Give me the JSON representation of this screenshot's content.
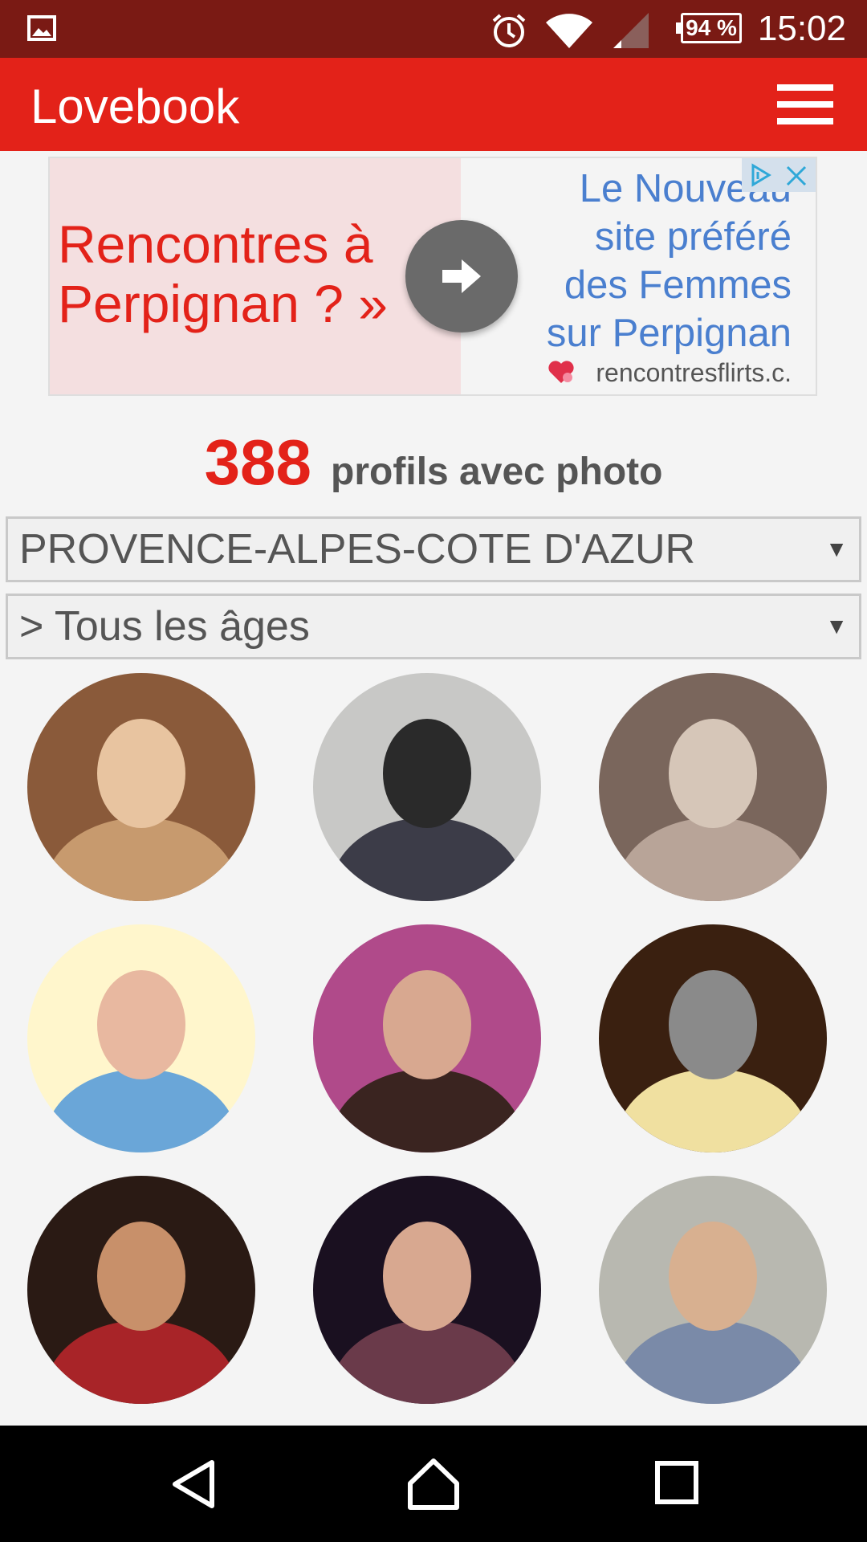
{
  "status_bar": {
    "time": "15:02",
    "battery": "94 %",
    "icons": [
      "gallery-icon",
      "alarm-icon",
      "wifi-icon",
      "signal-icon",
      "battery-icon"
    ]
  },
  "app_bar": {
    "title": "Lovebook",
    "menu_icon": "hamburger-menu-icon"
  },
  "ad": {
    "headline_line1": "Rencontres à",
    "headline_line2": "Perpignan ? »",
    "text_line1": "Le Nouveau",
    "text_line2": "site préféré",
    "text_line3": "des Femmes",
    "text_line4": "sur Perpignan",
    "url": "rencontresflirts.c.",
    "icons": [
      "arrow-right-icon",
      "heart-icon",
      "adchoices-icon",
      "close-icon"
    ]
  },
  "profiles": {
    "count": "388",
    "count_label": "profils avec photo"
  },
  "filters": {
    "region": "PROVENCE-ALPES-COTE D'AZUR",
    "age": "> Tous les âges",
    "caret": "▼"
  },
  "profile_photos": [
    {
      "colors": [
        "#8a5a3a",
        "#c79a6e",
        "#e8c4a0"
      ]
    },
    {
      "colors": [
        "#c8c8c6",
        "#3c3c48",
        "#2a2a2a"
      ]
    },
    {
      "colors": [
        "#7a665c",
        "#b8a498",
        "#d6c6b8"
      ]
    },
    {
      "colors": [
        "#fff6cc",
        "#6aa6d8",
        "#e8b8a0"
      ]
    },
    {
      "colors": [
        "#b04a8a",
        "#3a2420",
        "#d8a890"
      ]
    },
    {
      "colors": [
        "#3a2010",
        "#f0e0a0",
        "#8a8a8a"
      ]
    },
    {
      "colors": [
        "#2a1a14",
        "#a82428",
        "#c8906a"
      ]
    },
    {
      "colors": [
        "#1a1020",
        "#6a3a4a",
        "#d8a890"
      ]
    },
    {
      "colors": [
        "#b8b8b0",
        "#7a8aa8",
        "#d8b090"
      ]
    }
  ],
  "nav_bar": {
    "icons": [
      "back-icon",
      "home-icon",
      "recents-icon"
    ]
  }
}
